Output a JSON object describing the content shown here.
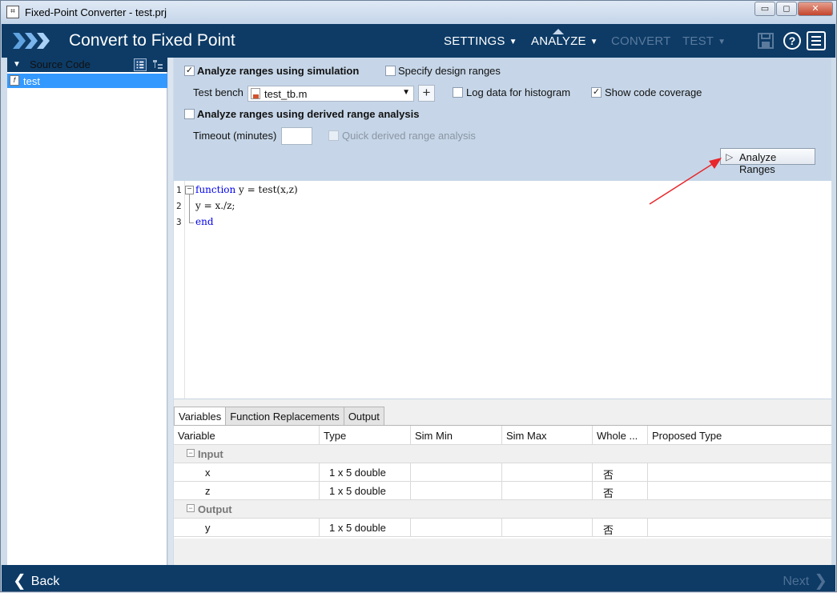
{
  "window": {
    "title": "Fixed-Point Converter - test.prj",
    "app_icon": "matlab-project-icon",
    "buttons": {
      "minimize": "▭",
      "maximize": "◻",
      "close": "✕"
    }
  },
  "header": {
    "title": "Convert to Fixed Point",
    "nav": [
      {
        "label": "SETTINGS",
        "caret": "▼",
        "state": "enabled"
      },
      {
        "label": "ANALYZE",
        "caret": "▼",
        "state": "active"
      },
      {
        "label": "CONVERT",
        "caret": "",
        "state": "disabled"
      },
      {
        "label": "TEST",
        "caret": "▼",
        "state": "disabled"
      }
    ],
    "icons": [
      "save-icon",
      "help-icon",
      "menu-icon"
    ]
  },
  "sidebar": {
    "header": "Source Code",
    "items": [
      {
        "label": "test",
        "icon": "function-file-icon",
        "selected": true
      }
    ]
  },
  "analyze": {
    "simulation_label": "Analyze ranges using simulation",
    "simulation_checked": "✓",
    "design_ranges_label": "Specify design ranges",
    "testbench_label": "Test bench",
    "testbench_value": "test_tb.m",
    "add_label": "+",
    "histogram_label": "Log data for histogram",
    "coverage_label": "Show code coverage",
    "coverage_checked": "✓",
    "derived_label": "Analyze ranges using derived range analysis",
    "timeout_label": "Timeout (minutes)",
    "timeout_value": "",
    "quick_label": "Quick derived range analysis",
    "button_label": "Analyze Ranges",
    "button_icon": "▷"
  },
  "code": {
    "lines": [
      {
        "num": "1",
        "keyword": "function",
        "rest": " y = test(x,z)"
      },
      {
        "num": "2",
        "keyword": "",
        "rest": "y = x./z;"
      },
      {
        "num": "3",
        "keyword": "end",
        "rest": ""
      }
    ],
    "fold_symbol": "−"
  },
  "bottom": {
    "tabs": [
      "Variables",
      "Function Replacements",
      "Output"
    ],
    "columns": [
      "Variable",
      "Type",
      "Sim Min",
      "Sim Max",
      "Whole ...",
      "Proposed Type"
    ],
    "groups": [
      {
        "name": "Input",
        "toggle": "−",
        "rows": [
          {
            "variable": "x",
            "type": "1 x 5 double",
            "sim_min": "",
            "sim_max": "",
            "whole": "否",
            "proposed": ""
          },
          {
            "variable": "z",
            "type": "1 x 5 double",
            "sim_min": "",
            "sim_max": "",
            "whole": "否",
            "proposed": ""
          }
        ]
      },
      {
        "name": "Output",
        "toggle": "−",
        "rows": [
          {
            "variable": "y",
            "type": "1 x 5 double",
            "sim_min": "",
            "sim_max": "",
            "whole": "否",
            "proposed": ""
          }
        ]
      }
    ]
  },
  "footer": {
    "back": "Back",
    "next": "Next",
    "back_chevron": "❮",
    "next_chevron": "❯"
  },
  "colors": {
    "header": "#0d3b66",
    "panel": "#c6d6e8",
    "selection": "#3399ff",
    "annotation_arrow": "#e8262b"
  }
}
